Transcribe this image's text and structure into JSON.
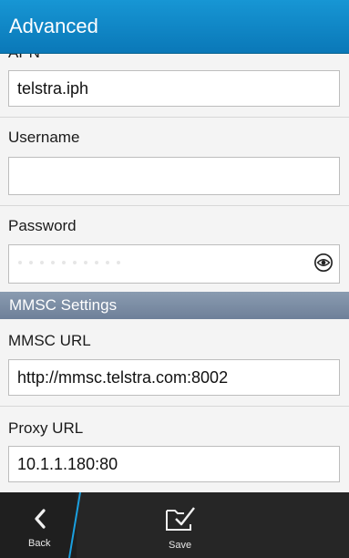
{
  "header": {
    "title": "Advanced"
  },
  "form": {
    "apn": {
      "label": "APN",
      "value": "telstra.iph"
    },
    "username": {
      "label": "Username",
      "value": ""
    },
    "password": {
      "label": "Password",
      "value": ""
    },
    "mmsc_group": {
      "header": "MMSC Settings"
    },
    "mmsc_url": {
      "label": "MMSC URL",
      "value": "http://mmsc.telstra.com:8002"
    },
    "proxy_url": {
      "label": "Proxy URL",
      "value": "10.1.1.180:80"
    }
  },
  "actionbar": {
    "back_label": "Back",
    "save_label": "Save"
  },
  "icons": {
    "back": "chevron-left-icon",
    "save": "folder-check-icon",
    "password_reveal": "eye-icon"
  },
  "colors": {
    "title_bar": "#0a78b8",
    "group_header": "#7a8ba3",
    "action_bar": "#262626",
    "accent_slash": "#1aa0e0"
  }
}
